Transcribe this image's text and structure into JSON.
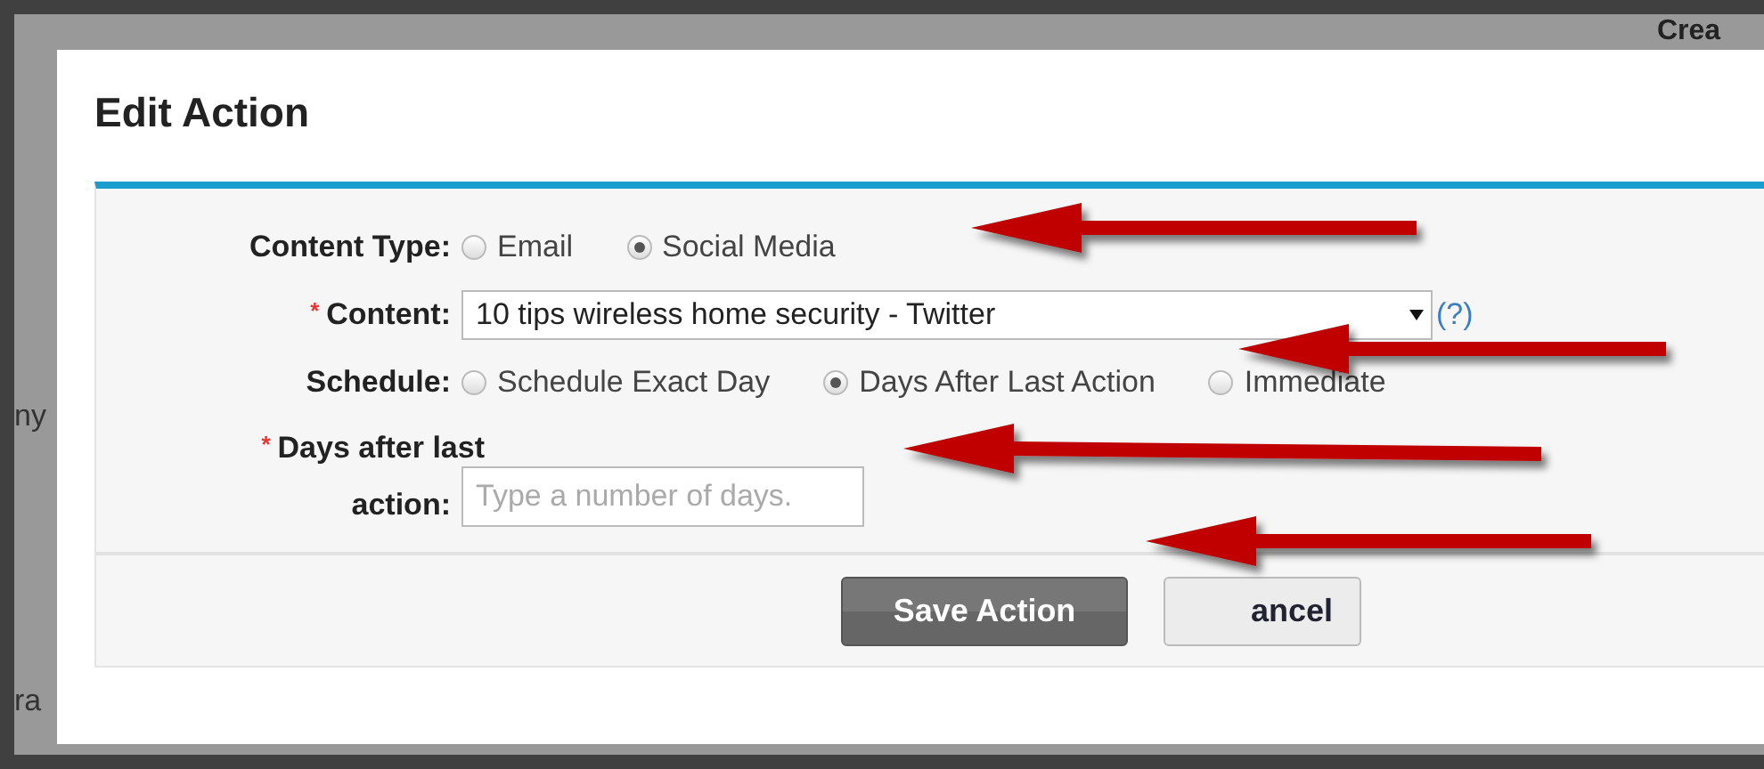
{
  "background": {
    "top_right_text": "Crea",
    "left_texts": [
      "ny",
      "ra"
    ]
  },
  "dialog": {
    "title": "Edit Action",
    "content_type": {
      "label": "Content Type:",
      "options": [
        {
          "label": "Email",
          "selected": false
        },
        {
          "label": "Social Media",
          "selected": true
        }
      ]
    },
    "content": {
      "label": "Content:",
      "required": true,
      "required_mark": "*",
      "value": "10 tips wireless home security - Twitter",
      "help": "(?)"
    },
    "schedule": {
      "label": "Schedule:",
      "options": [
        {
          "label": "Schedule Exact Day",
          "selected": false
        },
        {
          "label": "Days After Last Action",
          "selected": true
        },
        {
          "label": "Immediate",
          "selected": false
        }
      ]
    },
    "days": {
      "label_line_1": "Days after last",
      "label_line_2": "action:",
      "required": true,
      "required_mark": "*",
      "placeholder": "Type a number of days."
    },
    "buttons": [
      {
        "label": "Save Action",
        "kind": "primary"
      },
      {
        "label": "ancel",
        "kind": "secondary"
      }
    ]
  }
}
